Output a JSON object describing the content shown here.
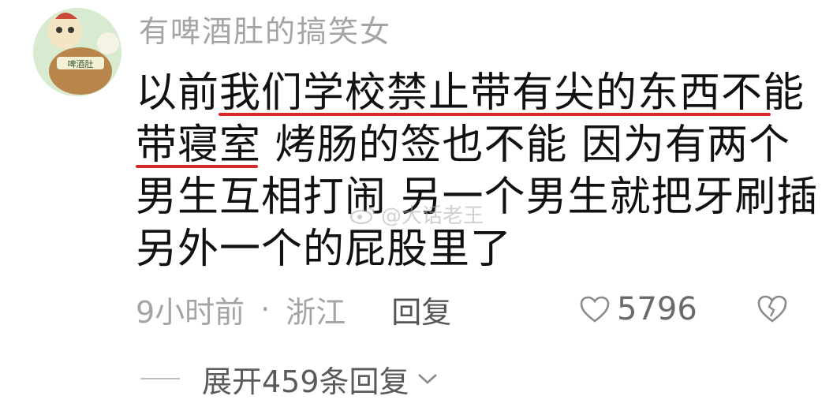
{
  "comment": {
    "username": "有啤酒肚的搞笑女",
    "avatar_text": "啤酒肚",
    "lines": [
      "以前我们学校禁止带有尖的东西不能",
      "带寝室  烤肠的签也不能 因为有两个",
      "男生互相打闹 另一个男生就把牙刷插",
      "另外一个的屁股里了"
    ],
    "time": "9小时前",
    "separator": "·",
    "location": "浙江",
    "reply_label": "回复",
    "like_count": "5796",
    "expand_label": "展开459条回复",
    "underline_color": "#d62a2a"
  },
  "watermark": {
    "text": "@大话老王"
  },
  "icons": {
    "like": "heart-outline-icon",
    "dislike": "broken-heart-icon",
    "expand": "chevron-down-icon",
    "watermark": "weibo-logo-icon"
  }
}
